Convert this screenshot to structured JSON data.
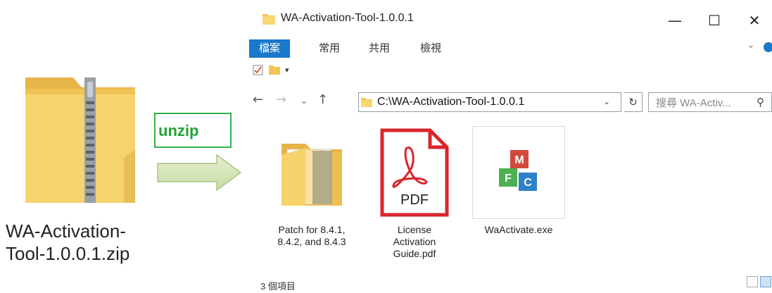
{
  "zip_file": {
    "name_line1": "WA-Activation-",
    "name_line2": "Tool-1.0.0.1.zip",
    "icon": "zip-folder-icon"
  },
  "annotation": {
    "label": "unzip",
    "arrow_icon": "right-arrow-icon",
    "color": "#23a336"
  },
  "window": {
    "title": "WA-Activation-Tool-1.0.0.1",
    "controls": {
      "minimize": "—",
      "maximize": "☐",
      "close": "✕"
    },
    "ribbon_tabs": [
      "檔案",
      "常用",
      "共用",
      "檢視"
    ],
    "accent": "#1979ca",
    "address": "C:\\WA-Activation-Tool-1.0.0.1",
    "search_placeholder": "搜尋 WA-Activ...",
    "items": [
      {
        "label": "Patch for 8.4.1,\n8.4.2, and 8.4.3",
        "icon": "folder-icon"
      },
      {
        "label": "License\nActivation\nGuide.pdf",
        "icon": "pdf-icon",
        "badge": "PDF"
      },
      {
        "label": "WaActivate.exe",
        "icon": "mfc-cubes-icon",
        "letters": [
          "M",
          "F",
          "C"
        ]
      }
    ],
    "status": "3 個項目"
  }
}
